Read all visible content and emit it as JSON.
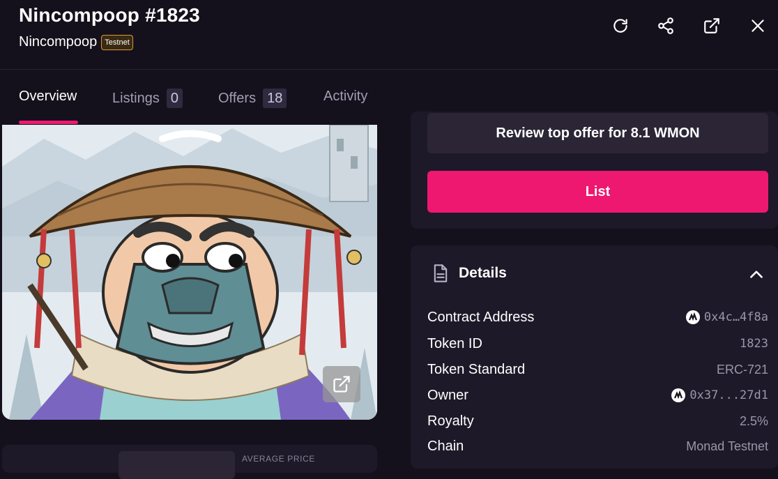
{
  "header": {
    "title": "Nincompoop #1823",
    "collection": "Nincompoop",
    "badge": "Testnet"
  },
  "tabs": [
    {
      "label": "Overview"
    },
    {
      "label": "Listings",
      "count": "0"
    },
    {
      "label": "Offers",
      "count": "18"
    },
    {
      "label": "Activity"
    }
  ],
  "actions": {
    "review_label": "Review top offer for 8.1 WMON",
    "list_label": "List"
  },
  "stats": {
    "avg_label": "AVERAGE PRICE"
  },
  "details": {
    "title": "Details",
    "rows": [
      {
        "label": "Contract Address",
        "value": "0x4c…4f8a"
      },
      {
        "label": "Token ID",
        "value": "1823"
      },
      {
        "label": "Token Standard",
        "value": "ERC-721"
      },
      {
        "label": "Owner",
        "value": "0x37...27d1"
      },
      {
        "label": "Royalty",
        "value": "2.5%"
      },
      {
        "label": "Chain",
        "value": "Monad Testnet"
      }
    ]
  },
  "colors": {
    "accent": "#ee1870",
    "background": "#15111c",
    "card": "#1e1928",
    "badge_border": "#d99a3a"
  },
  "icons": [
    "refresh-icon",
    "share-icon",
    "external-link-icon",
    "close-icon",
    "document-icon",
    "chevron-up-icon",
    "expand-icon",
    "monad-logo-icon"
  ]
}
